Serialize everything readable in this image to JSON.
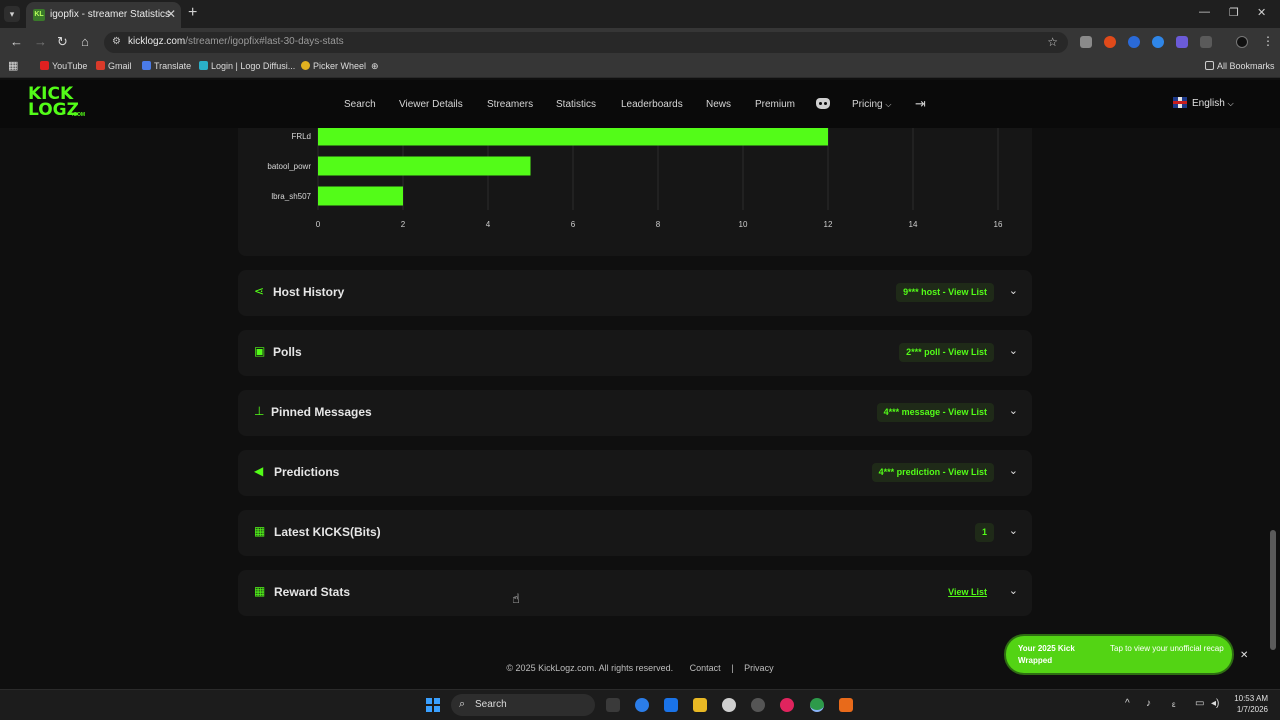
{
  "browser": {
    "tab_title": "igopfix - streamer Statistics",
    "tab_favicon_text": "KL",
    "url_host": "kicklogz.com",
    "url_path": "/streamer/igopfix#last-30-days-stats",
    "bookmarks": [
      "YouTube",
      "Gmail",
      "Translate",
      "Login | Logo Diffusi...",
      "Picker Wheel"
    ],
    "all_bookmarks": "All Bookmarks"
  },
  "site": {
    "logo_top": "KICK",
    "logo_bottom": "LOGZ",
    "logo_suffix": ".COM",
    "nav": [
      "Search",
      "Viewer Details",
      "Streamers",
      "Statistics",
      "Leaderboards",
      "News",
      "Premium"
    ],
    "pricing": "Pricing",
    "language": "English",
    "accent_color": "#53fc18"
  },
  "chart_data": {
    "type": "bar",
    "orientation": "horizontal",
    "categories": [
      "FRLd",
      "batool_powr",
      "lbra_sh507"
    ],
    "values": [
      12,
      5,
      2
    ],
    "xlim": [
      0,
      16
    ],
    "xticks": [
      0,
      2,
      4,
      6,
      8,
      10,
      12,
      14,
      16
    ],
    "grid": true,
    "bar_color": "#53fc18"
  },
  "sections": [
    {
      "title": "Host History",
      "badge": "9*** host - View List",
      "icon": "share-icon"
    },
    {
      "title": "Polls",
      "badge": "2*** poll - View List",
      "icon": "poll-icon"
    },
    {
      "title": "Pinned Messages",
      "badge": "4*** message - View List",
      "icon": "pin-icon"
    },
    {
      "title": "Predictions",
      "badge": "4*** prediction - View List",
      "icon": "megaphone-icon"
    },
    {
      "title": "Latest KICKS(Bits)",
      "badge": "1",
      "icon": "gift-icon"
    },
    {
      "title": "Reward Stats",
      "badge": "View List",
      "icon": "gift-icon"
    }
  ],
  "footer": {
    "copyright": "© 2025 KickLogz.com. All rights reserved.",
    "contact": "Contact",
    "separator": "|",
    "privacy": "Privacy"
  },
  "toast": {
    "title": "Your 2025 Kick Wrapped",
    "text": "Tap to view your unofficial recap"
  },
  "taskbar": {
    "search": "Search",
    "time": "10:53 AM",
    "date": "1/7/2026"
  }
}
